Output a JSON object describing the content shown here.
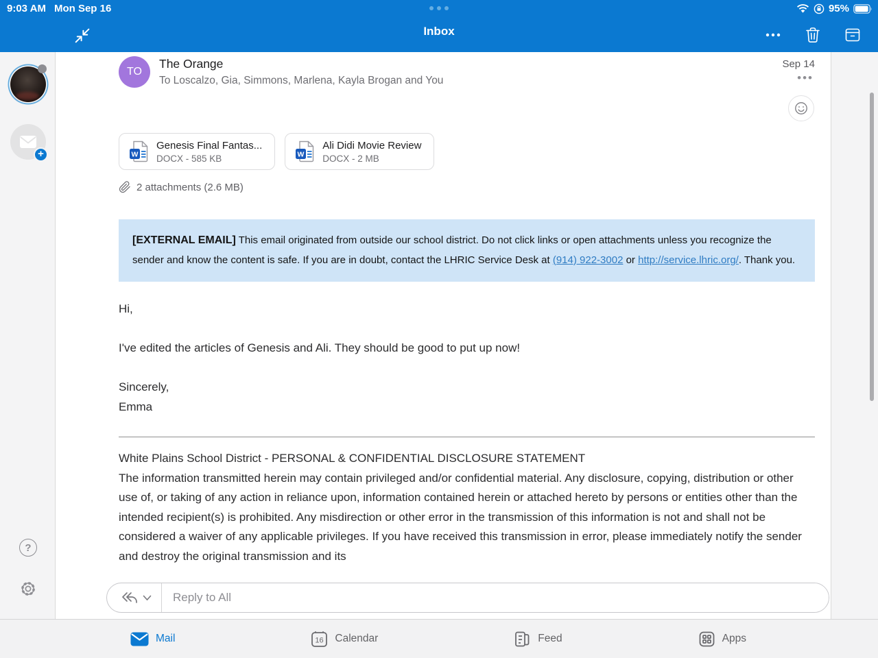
{
  "colors": {
    "header_blue": "#0b79d1",
    "banner_bg": "#cfe4f7",
    "link_blue": "#2f7cc3",
    "avatar_purple": "#a276dd",
    "word_icon_blue": "#185abd"
  },
  "status_bar": {
    "time": "9:03 AM",
    "date": "Mon Sep 16",
    "battery_percent": "95%"
  },
  "nav_bar": {
    "title": "Inbox"
  },
  "email": {
    "avatar_initials": "TO",
    "sender": "The Orange",
    "recipients": "To Loscalzo, Gia, Simmons, Marlena, Kayla Brogan and You",
    "date": "Sep 14",
    "more_glyph": "•••",
    "attachments": [
      {
        "name": "Genesis Final Fantas...",
        "meta": "DOCX - 585 KB"
      },
      {
        "name": "Ali Didi Movie Review",
        "meta": "DOCX - 2 MB"
      }
    ],
    "attachments_summary": "2 attachments (2.6 MB)",
    "external_banner": {
      "label": "[EXTERNAL EMAIL]",
      "text_1": " This email originated from outside our school district. Do not click links or open attachments unless you recognize the sender and know the content is safe. If you are in doubt, contact the LHRIC Service Desk at ",
      "phone_link": "(914) 922-3002",
      "text_2": " or ",
      "url_link": "http://service.lhric.org/",
      "text_3": ". Thank you."
    },
    "body": {
      "greeting": "Hi,",
      "message": "I've edited the articles of Genesis and Ali. They should be good to put up now!",
      "closing": "Sincerely,",
      "signature": "Emma"
    },
    "disclosure": {
      "title": "White Plains School District - PERSONAL & CONFIDENTIAL DISCLOSURE STATEMENT",
      "body": "The information transmitted herein may contain privileged and/or confidential material. Any disclosure, copying, distribution or other use of, or taking of any action in reliance upon, information contained herein or attached hereto by persons or entities other than the intended recipient(s) is prohibited. Any misdirection or other error in the transmission of this information is not and shall not be considered a waiver of any applicable privileges. If you have received this transmission in error, please immediately notify the sender and destroy the original transmission and its"
    }
  },
  "reply_bar": {
    "placeholder": "Reply to All"
  },
  "tab_bar": {
    "items": [
      {
        "label": "Mail",
        "active": true
      },
      {
        "label": "Calendar",
        "badge": "16"
      },
      {
        "label": "Feed"
      },
      {
        "label": "Apps"
      }
    ]
  }
}
